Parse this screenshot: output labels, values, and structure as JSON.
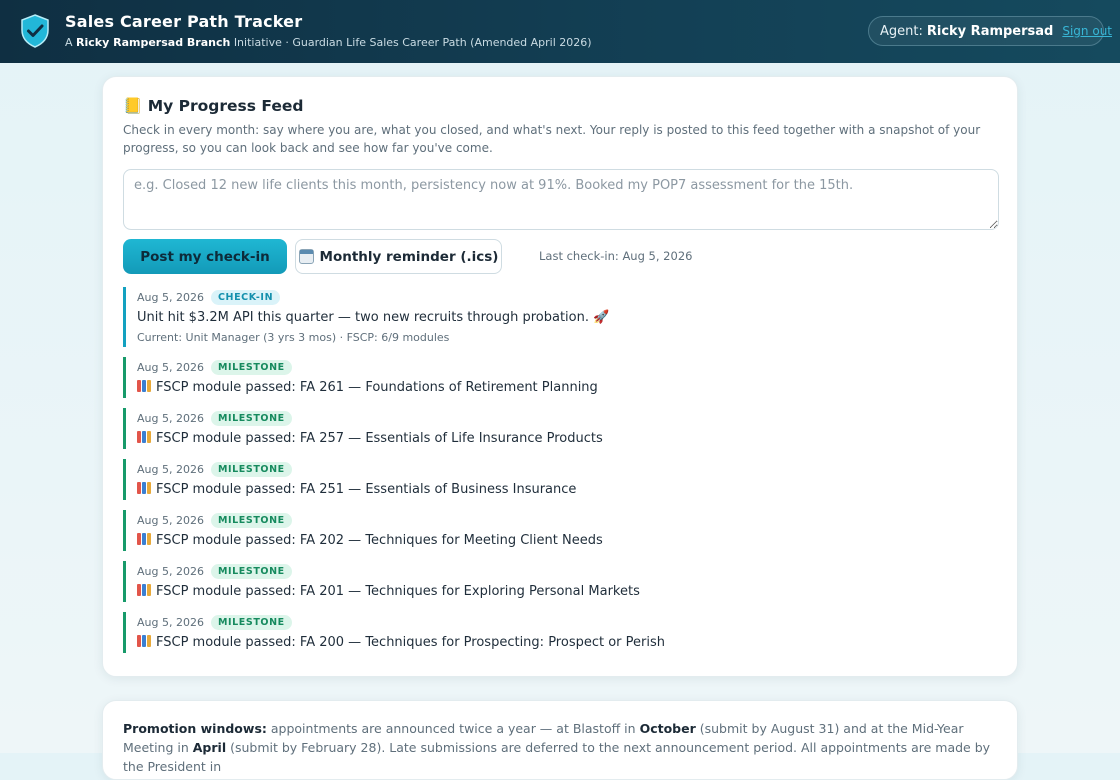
{
  "header": {
    "title": "Sales Career Path Tracker",
    "subtitle_prefix": "A",
    "subtitle_branch": "Ricky Rampersad Branch",
    "subtitle_suffix": "Initiative · Guardian Life Sales Career Path (Amended April 2026)",
    "agent_label": "Agent:",
    "agent_name": "Ricky Rampersad",
    "sign_out": "Sign out",
    "accent_color": "#13a1c0"
  },
  "feed": {
    "icon": "notebook-icon",
    "title": "📒 My Progress Feed",
    "description": "Check in every month: say where you are, what you closed, and what's next. Your reply is posted to this feed together with a snapshot of your progress, so you can look back and see how far you've come.",
    "input_placeholder": "e.g. Closed 12 new life clients this month, persistency now at 91%. Booked my POP7 assessment for the 15th.",
    "input_value": "",
    "post_button": "Post my check-in",
    "reminder_button": "Monthly reminder (.ics)",
    "reminder_icon": "calendar-icon",
    "last_checkin": "Last check-in: Aug 5, 2026",
    "items": [
      {
        "date": "Aug 5, 2026",
        "type": "checkin",
        "badge": "CHECK-IN",
        "text": "Unit hit $3.2M API this quarter — two new recruits through probation. 🚀",
        "snapshot": "Current: Unit Manager (3 yrs 3 mos) · FSCP: 6/9 modules"
      },
      {
        "date": "Aug 5, 2026",
        "type": "milestone",
        "badge": "MILESTONE",
        "text": "FSCP module passed: FA 261 — Foundations of Retirement Planning"
      },
      {
        "date": "Aug 5, 2026",
        "type": "milestone",
        "badge": "MILESTONE",
        "text": "FSCP module passed: FA 257 — Essentials of Life Insurance Products"
      },
      {
        "date": "Aug 5, 2026",
        "type": "milestone",
        "badge": "MILESTONE",
        "text": "FSCP module passed: FA 251 — Essentials of Business Insurance"
      },
      {
        "date": "Aug 5, 2026",
        "type": "milestone",
        "badge": "MILESTONE",
        "text": "FSCP module passed: FA 202 — Techniques for Meeting Client Needs"
      },
      {
        "date": "Aug 5, 2026",
        "type": "milestone",
        "badge": "MILESTONE",
        "text": "FSCP module passed: FA 201 — Techniques for Exploring Personal Markets"
      },
      {
        "date": "Aug 5, 2026",
        "type": "milestone",
        "badge": "MILESTONE",
        "text": "FSCP module passed: FA 200 — Techniques for Prospecting: Prospect or Perish"
      }
    ]
  },
  "promotion": {
    "label": "Promotion windows:",
    "part1": "appointments are announced twice a year — at Blastoff in",
    "month1": "October",
    "part2": "(submit by August 31) and at the Mid-Year Meeting in",
    "month2": "April",
    "part3": "(submit by February 28). Late submissions are deferred to the next announcement period. All appointments are made by the President in"
  }
}
